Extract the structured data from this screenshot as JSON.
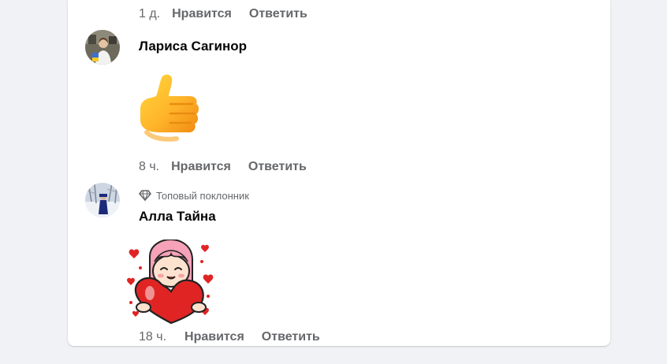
{
  "comments": [
    {
      "time": "1 д.",
      "like_label": "Нравится",
      "reply_label": "Ответить"
    },
    {
      "author": "Лариса Сагинор",
      "sticker_icon": "thumbs-up-emoji",
      "time": "8 ч.",
      "like_label": "Нравится",
      "reply_label": "Ответить"
    },
    {
      "badge": "Топовый поклонник",
      "badge_icon": "diamond-icon",
      "author": "Алла Тайна",
      "sticker_icon": "girl-holding-heart-sticker",
      "time": "18 ч.",
      "like_label": "Нравится",
      "reply_label": "Ответить"
    }
  ],
  "colors": {
    "page_background": "#f0f2f5",
    "card_background": "#ffffff",
    "secondary_text": "#65676b",
    "primary_text": "#050505",
    "heart_red": "#e02424"
  }
}
